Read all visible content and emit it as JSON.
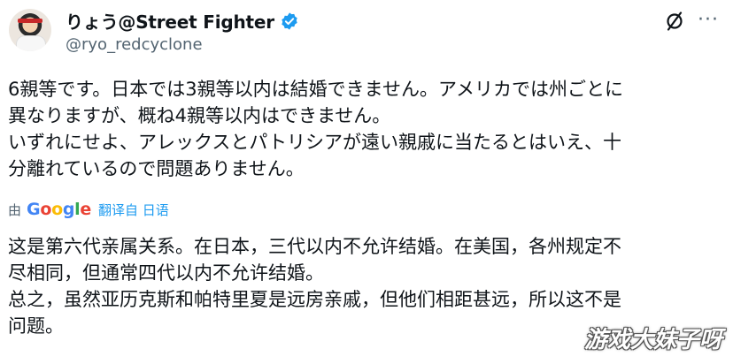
{
  "header": {
    "display_name": "りょう@Street Fighter",
    "handle": "@ryo_redcyclone",
    "verified_icon": "verified-badge-icon",
    "grok_icon": "slashed-circle-icon",
    "more_label": "···"
  },
  "tweet": {
    "lines": [
      "6親等です。日本では3親等以内は結婚できません。アメリカでは州ごとに",
      "異なりますが、概ね4親等以内はできません。",
      "いずれにせよ、アレックスとパトリシアが遠い親戚に当たるとはいえ、十",
      "分離れているので問題ありません。"
    ]
  },
  "translation": {
    "by_label": "由",
    "provider": "Google",
    "link_label": "翻译自 日语",
    "lines": [
      "这是第六代亲属关系。在日本，三代以内不允许结婚。在美国，各州规定不",
      "尽相同，但通常四代以内不允许结婚。",
      "总之，虽然亚历克斯和帕特里夏是远房亲戚，但他们相距甚远，所以这不是",
      "问题。"
    ]
  },
  "watermark": "游戏大妹子呀",
  "colors": {
    "text": "#0f1419",
    "secondary": "#536471",
    "link": "#1d9bf0",
    "verified": "#1d9bf0"
  }
}
